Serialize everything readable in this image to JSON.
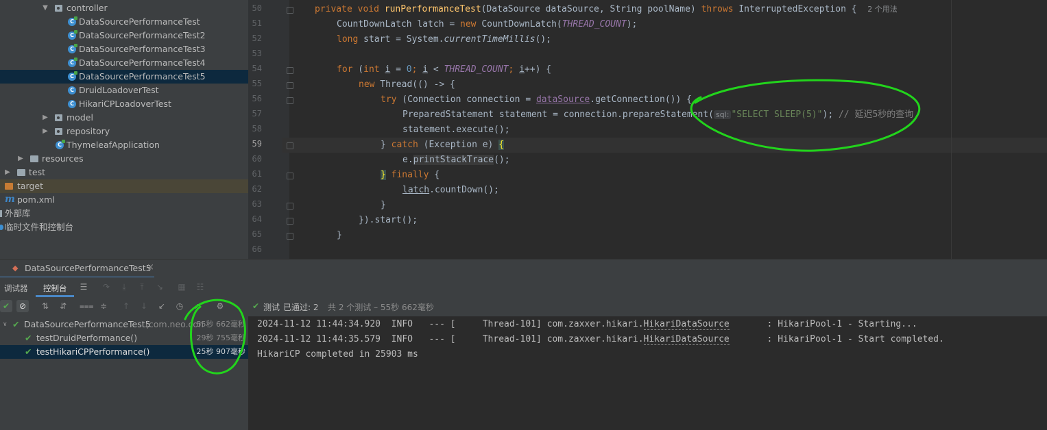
{
  "tree": {
    "items": [
      {
        "label": "controller",
        "type": "package",
        "expanded": true,
        "indent": 0
      },
      {
        "label": "DataSourcePerformanceTest",
        "type": "class"
      },
      {
        "label": "DataSourcePerformanceTest2",
        "type": "class"
      },
      {
        "label": "DataSourcePerformanceTest3",
        "type": "class"
      },
      {
        "label": "DataSourcePerformanceTest4",
        "type": "class"
      },
      {
        "label": "DataSourcePerformanceTest5",
        "type": "class",
        "selected": true
      },
      {
        "label": "DruidLoadoverTest",
        "type": "class"
      },
      {
        "label": "HikariCPLoadoverTest",
        "type": "class"
      },
      {
        "label": "model",
        "type": "package"
      },
      {
        "label": "repository",
        "type": "package"
      },
      {
        "label": "ThymeleafApplication",
        "type": "class"
      },
      {
        "label": "resources",
        "type": "folder"
      },
      {
        "label": "test",
        "type": "folder"
      },
      {
        "label": "target",
        "type": "folder"
      },
      {
        "label": "pom.xml",
        "type": "maven"
      },
      {
        "label": "外部库",
        "type": "library"
      },
      {
        "label": "临时文件和控制台",
        "type": "scratch"
      }
    ]
  },
  "editor": {
    "line_numbers": [
      "50",
      "51",
      "52",
      "53",
      "54",
      "55",
      "56",
      "57",
      "58",
      "59",
      "60",
      "61",
      "62",
      "63",
      "64",
      "65",
      "66"
    ],
    "current_line": "59",
    "code": {
      "l50_private": "private",
      "l50_void": "void",
      "l50_fn": "runPerformanceTest",
      "l50_params": "(DataSource dataSource, String poolName) ",
      "l50_throws": "throws",
      "l50_exc": " InterruptedException {",
      "l50_usage": "2 个用法",
      "l51_a": "CountDownLatch latch = ",
      "l51_new": "new",
      "l51_b": " CountDownLatch(",
      "l51_const": "THREAD_COUNT",
      "l51_c": ");",
      "l52_long": "long",
      "l52_a": " start = System.",
      "l52_it": "currentTimeMillis",
      "l52_b": "();",
      "l54_for": "for",
      "l54_a": " (",
      "l54_int": "int",
      "l54_i": "i",
      "l54_b": " = ",
      "l54_zero": "0",
      "l54_semi": "; ",
      "l54_i2": "i",
      "l54_lt": " < ",
      "l54_const": "THREAD_COUNT",
      "l54_semi2": "; ",
      "l54_i3": "i",
      "l54_end": "++) {",
      "l55_new": "new",
      "l55_a": " Thread(() -> {",
      "l56_try": "try",
      "l56_a": " (Connection connection = ",
      "l56_ds": "dataSource",
      "l56_b": ".getConnection()) {",
      "l57_a": "PreparedStatement statement = connection.prepareStatement(",
      "l57_hint": "sql:",
      "l57_str": "\"SELECT SLEEP(5)\"",
      "l57_b": ");",
      "l57_cmt": "// 延迟5秒的查询",
      "l58": "statement.execute();",
      "l59_a": "} ",
      "l59_catch": "catch",
      "l59_b": " (Exception e) ",
      "l59_brace": "{",
      "l60_a": "e.",
      "l60_fn": "printStackTrace",
      "l60_b": "();",
      "l61_brace": "}",
      "l61_finally": " finally",
      "l61_b": " {",
      "l62_latch": "latch",
      "l62_b": ".countDown();",
      "l63": "}",
      "l64": "}).start();",
      "l65": "}"
    }
  },
  "run": {
    "tab_title": "DataSourcePerformanceTest5",
    "tab_close": "×",
    "tabs": [
      "调试器",
      "控制台"
    ],
    "status_check": "✔",
    "status_prefix": "测试",
    "status_passed": "已通过: 2",
    "status_rest": "共 2 个测试 – 55秒 662毫秒",
    "tests": [
      {
        "name": "DataSourcePerformanceTest5",
        "pkg": "(com.neo.con",
        "duration": "55秒 662毫秒",
        "indent": 0
      },
      {
        "name": "testDruidPerformance()",
        "duration": "29秒 755毫秒",
        "indent": 1
      },
      {
        "name": "testHikariCPPerformance()",
        "duration": "25秒 907毫秒",
        "indent": 1,
        "selected": true
      }
    ],
    "console": {
      "line1_a": "2024-11-12 11:44:34.920  INFO   --- [     Thread-101] com.zaxxer.hikari.",
      "line1_cls": "HikariDataSource",
      "line1_b": "       : HikariPool-1 - Starting...",
      "line2_a": "2024-11-12 11:44:35.579  INFO   --- [     Thread-101] com.zaxxer.hikari.",
      "line2_cls": "HikariDataSource",
      "line2_b": "       : HikariPool-1 - Start completed.",
      "line3": "HikariCP completed in 25903 ms"
    }
  }
}
